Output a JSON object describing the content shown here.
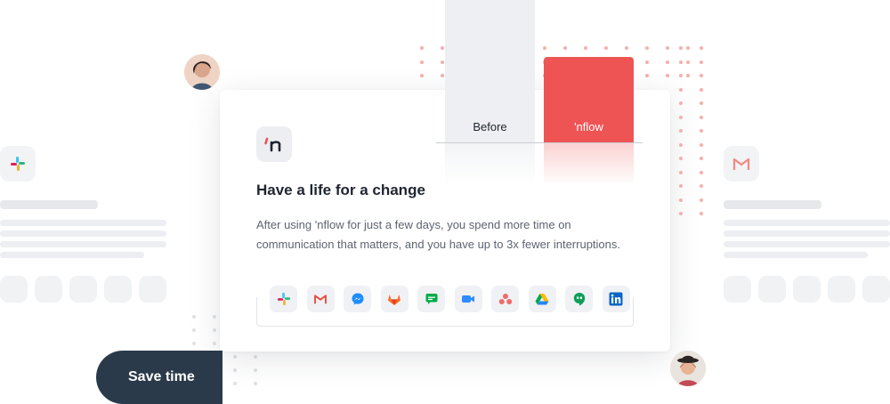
{
  "card": {
    "logo_text": "'n",
    "title": "Have a life for a change",
    "description": "After using 'nflow for just a few days, you spend more time on communication that matters, and you have up to 3x fewer interruptions."
  },
  "chart_data": {
    "type": "bar",
    "categories": [
      "Before",
      "'nflow"
    ],
    "values": [
      100,
      60
    ],
    "title": "",
    "xlabel": "",
    "ylabel": "",
    "colors": [
      "#eeeff2",
      "#ef5455"
    ]
  },
  "apps": [
    {
      "name": "slack-icon"
    },
    {
      "name": "gmail-icon"
    },
    {
      "name": "messenger-icon"
    },
    {
      "name": "gitlab-icon"
    },
    {
      "name": "google-chat-icon"
    },
    {
      "name": "zoom-icon"
    },
    {
      "name": "asana-icon"
    },
    {
      "name": "google-drive-icon"
    },
    {
      "name": "hangouts-icon"
    },
    {
      "name": "linkedin-icon"
    }
  ],
  "save_time": {
    "label": "Save time"
  },
  "colors": {
    "accent": "#ef5455",
    "dark": "#2b3a4a"
  }
}
